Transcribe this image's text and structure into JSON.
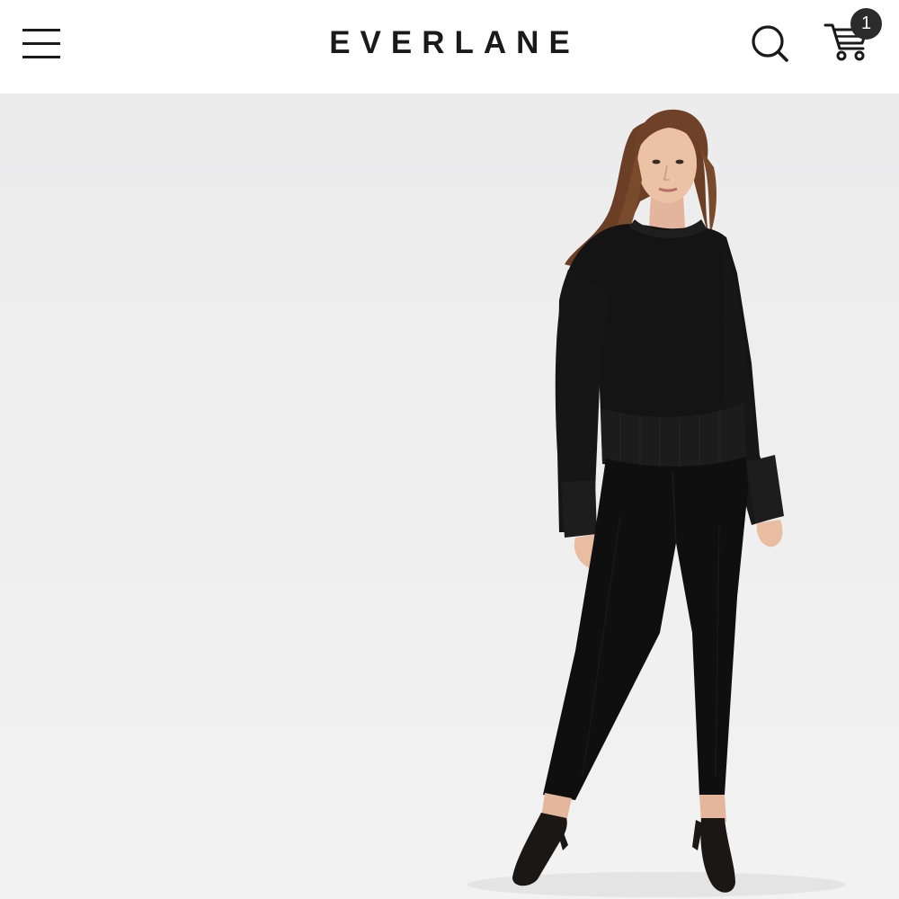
{
  "header": {
    "brand": "EVERLANE",
    "menu_icon": "hamburger-menu-icon",
    "search_icon": "search-icon",
    "cart_icon": "shopping-cart-icon",
    "cart_count": "1"
  },
  "hero": {
    "image": "model-black-sweater-black-pants"
  },
  "colors": {
    "header_bg": "#ffffff",
    "hero_bg": "#eeeeee",
    "text": "#1a1a1a",
    "badge_bg": "#2b2b2b",
    "badge_text": "#ffffff"
  }
}
